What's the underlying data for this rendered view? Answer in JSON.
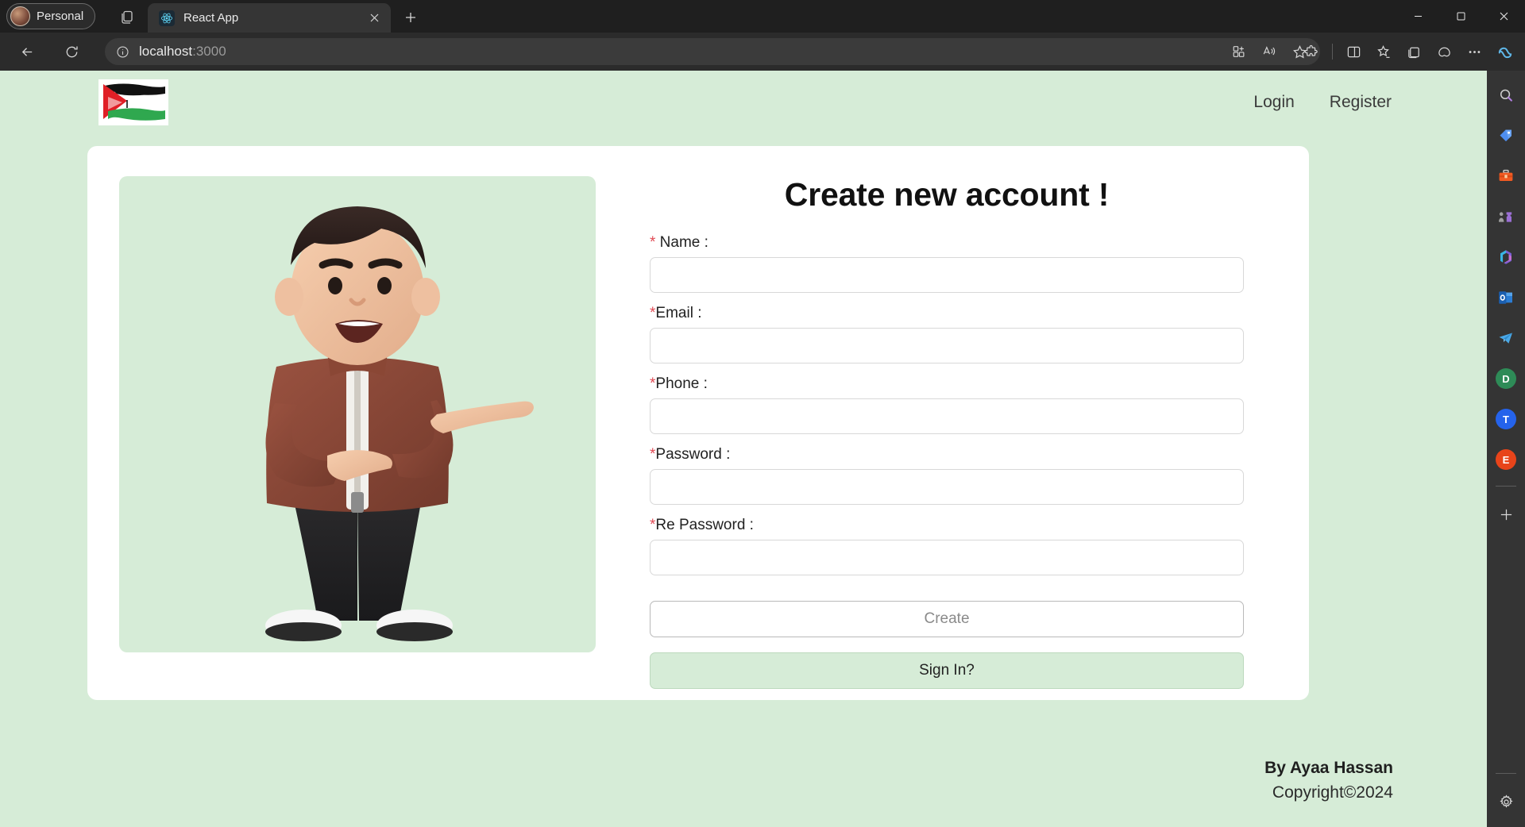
{
  "browser": {
    "profile_label": "Personal",
    "tab": {
      "title": "React App",
      "favicon": "react-icon",
      "close": "close-icon"
    },
    "new_tab_label": "+",
    "address": {
      "host": "localhost",
      "port": ":3000",
      "info_icon": "info-icon"
    },
    "toolbar_icons": [
      "back-icon",
      "refresh-icon",
      "split-screen-icon",
      "read-aloud-icon",
      "favorite-star-icon",
      "extensions-icon",
      "split-pane-icon",
      "collections-favorites-icon",
      "collections-icon",
      "browser-essentials-icon",
      "settings-more-icon",
      "copilot-icon"
    ],
    "window_controls": [
      "minimize-icon",
      "maximize-icon",
      "close-window-icon"
    ]
  },
  "rail": {
    "items": [
      {
        "name": "search-icon",
        "label": ""
      },
      {
        "name": "shopping-tag-icon",
        "label": ""
      },
      {
        "name": "tools-toolbox-icon",
        "label": ""
      },
      {
        "name": "games-chess-icon",
        "label": ""
      },
      {
        "name": "microsoft-365-icon",
        "label": ""
      },
      {
        "name": "outlook-icon",
        "label": ""
      },
      {
        "name": "telegram-icon",
        "label": ""
      },
      {
        "name": "app-d-icon",
        "label": "D"
      },
      {
        "name": "app-t-icon",
        "label": "T"
      },
      {
        "name": "app-e-icon",
        "label": "E"
      }
    ],
    "add_label": "+",
    "settings_icon": "gear-icon"
  },
  "page": {
    "logo_alt": "palestine-flag-logo",
    "nav": [
      {
        "label": "Login",
        "name": "nav-link-login"
      },
      {
        "label": "Register",
        "name": "nav-link-register"
      }
    ],
    "illustration_alt": "3d-character-pointing",
    "form": {
      "title": "Create new account !",
      "required_mark": "*",
      "fields": [
        {
          "name": "name",
          "label": " Name :",
          "value": "",
          "placeholder": "",
          "type": "text",
          "mark_spaced": true
        },
        {
          "name": "email",
          "label": "Email :",
          "value": "",
          "placeholder": "",
          "type": "text",
          "mark_spaced": false
        },
        {
          "name": "phone",
          "label": "Phone :",
          "value": "",
          "placeholder": "",
          "type": "text",
          "mark_spaced": false
        },
        {
          "name": "password",
          "label": "Password :",
          "value": "",
          "placeholder": "",
          "type": "password",
          "mark_spaced": false
        },
        {
          "name": "repassword",
          "label": "Re Password :",
          "value": "",
          "placeholder": "",
          "type": "password",
          "mark_spaced": false
        }
      ],
      "submit_label": "Create",
      "signin_label": "Sign In?"
    },
    "footer": {
      "by": "By Ayaa Hassan",
      "copyright": "Copyright©2024"
    }
  },
  "colors": {
    "page_bg": "#d6ecd7",
    "card_bg": "#ffffff",
    "accent_green": "#d6ecd7",
    "required_red": "#e04a54",
    "chrome_bg": "#2b2b2b",
    "titlebar_bg": "#1f1f1f",
    "rail_bg": "#343434"
  }
}
